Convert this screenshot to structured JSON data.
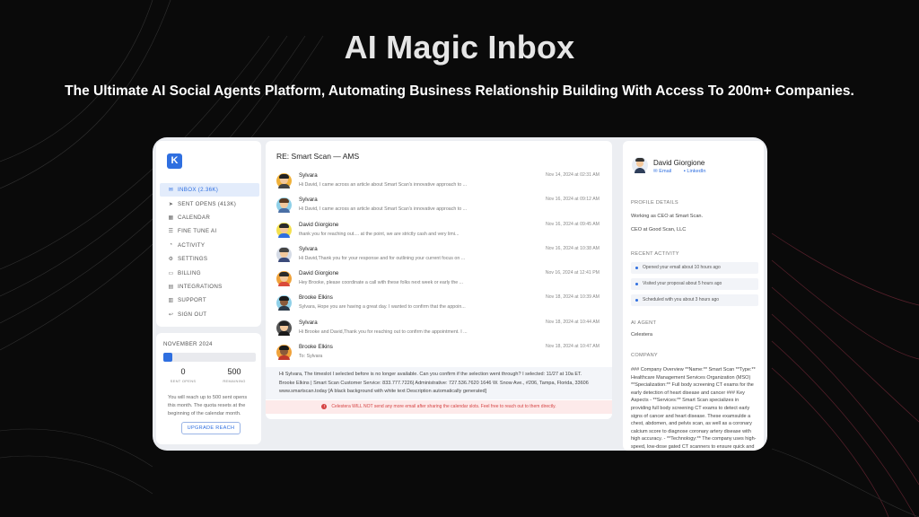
{
  "hero": {
    "title": "AI Magic Inbox",
    "subtitle": "The Ultimate AI Social Agents Platform, Automating Business Relationship Building With Access To 200m+ Companies."
  },
  "app": {
    "logo_letter": "K",
    "nav": [
      {
        "label": "INBOX (2.36K)",
        "icon": "mail-icon",
        "glyph": "✉",
        "active": true
      },
      {
        "label": "SENT OPENS (413K)",
        "icon": "send-icon",
        "glyph": "➤",
        "active": false
      },
      {
        "label": "CALENDAR",
        "icon": "calendar-icon",
        "glyph": "▦",
        "active": false
      },
      {
        "label": "FINE TUNE AI",
        "icon": "sliders-icon",
        "glyph": "☰",
        "active": false
      },
      {
        "label": "ACTIVITY",
        "icon": "bell-icon",
        "glyph": "◔",
        "active": false
      },
      {
        "label": "SETTINGS",
        "icon": "gear-icon",
        "glyph": "⚙",
        "active": false
      },
      {
        "label": "BILLING",
        "icon": "billing-icon",
        "glyph": "▭",
        "active": false
      },
      {
        "label": "INTEGRATIONS",
        "icon": "integrations-icon",
        "glyph": "▤",
        "active": false
      },
      {
        "label": "SUPPORT",
        "icon": "support-icon",
        "glyph": "▥",
        "active": false
      },
      {
        "label": "SIGN OUT",
        "icon": "sign-out-icon",
        "glyph": "↩",
        "active": false
      }
    ],
    "quota": {
      "month": "NOVEMBER 2024",
      "progress": 0.1,
      "sent_value": "0",
      "sent_label": "SENT OPENS",
      "remaining_value": "500",
      "remaining_label": "REMAINING",
      "note": "You will reach up to 500 sent opens this month. The quota resets at the beginning of the calendar month.",
      "upgrade_label": "UPGRADE REACH"
    },
    "thread": {
      "title": "RE: Smart Scan — AMS",
      "messages": [
        {
          "name": "Sylvara",
          "date": "Nov 14, 2024 at 02:31 AM",
          "snippet": "Hi David, I came across an article about Smart Scan's innovative approach to ..."
        },
        {
          "name": "Sylvara",
          "date": "Nov 16, 2024 at 09:12 AM",
          "snippet": "Hi David, I came across an article about Smart Scan's innovative approach to ..."
        },
        {
          "name": "David Giorgione",
          "date": "Nov 16, 2024 at 09:45 AM",
          "snippet": "thank you for reaching out.... at the point, we are strictly cash and very limi..."
        },
        {
          "name": "Sylvara",
          "date": "Nov 16, 2024 at 10:38 AM",
          "snippet": "Hi David,Thank you for your response and for outlining your current focus on ..."
        },
        {
          "name": "David Giorgione",
          "date": "Nov 16, 2024 at 12:41 PM",
          "snippet": "Hey Brooke, please coordinate a call with these folks next week or early the ..."
        },
        {
          "name": "Brooke Elkins",
          "date": "Nov 18, 2024 at 10:39 AM",
          "snippet": "Sylvara, Hope you are having a great day. I wanted to confirm that the appoin..."
        },
        {
          "name": "Sylvara",
          "date": "Nov 18, 2024 at 10:44 AM",
          "snippet": "Hi Brooke and David,Thank you for reaching out to confirm the appointment. I ..."
        },
        {
          "name": "Brooke Elkins",
          "date": "Nov 18, 2024 at 10:47 AM",
          "to_label": "To:",
          "to": "Sylvara"
        }
      ],
      "body": "Hi Sylvara, The timeslot I selected before is no longer available. Can you confirm if the selection went through? I selected: 11/27 at 10a ET. Brooke Elkins | Smart Scan Customer Service: 833.777.7226| Administrative: 727.536.7620 1646 W. Snow Ave., #206, Tampa, Florida, 33606 www.smartscan.today [A black background with white text Description automatically generated]",
      "warning": "Celestera WILL NOT send any more email after sharing the calendar slots. Feel free to reach out to them directly."
    },
    "contact": {
      "name": "David Giorgione",
      "email_label": "Email",
      "linkedin_label": "LinkedIn",
      "profile_heading": "PROFILE DETAILS",
      "profile_lines": [
        "Working as CEO at Smart Scan.",
        "CEO at Good Scan, LLC"
      ],
      "activity_heading": "RECENT ACTIVITY",
      "activities": [
        "Opened your email about 10 hours ago",
        "Visited your proposal about 5 hours ago",
        "Scheduled with you about 3 hours ago"
      ],
      "agent_heading": "AI AGENT",
      "agent_name": "Celestera",
      "company_heading": "COMPANY",
      "company_text": "### Company Overview **Name:** Smart Scan **Type:** Healthcare Management Services Organization (MSO) **Specialization:** Full body screening CT exams for the early detection of heart disease and cancer ### Key Aspects - **Services:** Smart Scan specializes in providing full body screening CT exams to detect early signs of cancer and heart disease. These examsulde a chest, abdomen, and pelvis scan, as well as a coronary calcium score to diagnose coronary artery disease with high accuracy. - **Technology:** The company uses high-speed, low-dose gated CT scanners to ensure quick and non-invasive imaging. The scans are"
    }
  }
}
